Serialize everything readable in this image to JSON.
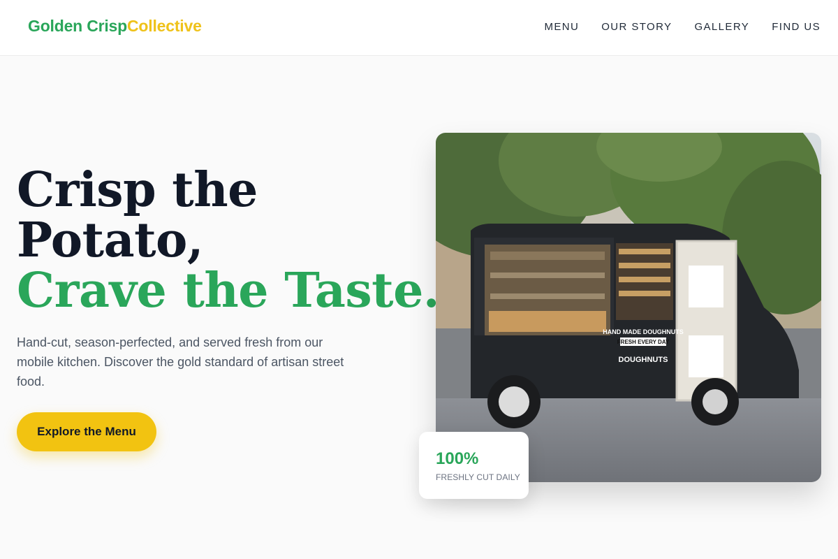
{
  "header": {
    "logo_part1": "Golden Crisp",
    "logo_part2": "Collective",
    "nav": [
      "MENU",
      "OUR STORY",
      "GALLERY",
      "FIND US"
    ]
  },
  "hero": {
    "title_line1": "Crisp the",
    "title_line2": "Potato,",
    "title_line3": "Crave the Taste.",
    "description": "Hand-cut, season-perfected, and served fresh from our mobile kitchen. Discover the gold standard of artisan street food.",
    "cta_label": "Explore the Menu"
  },
  "image": {
    "truck_signs": [
      "HAND MADE DOUGHNUTS",
      "FRESH EVERY DAY",
      "DOUGHNUTS"
    ]
  },
  "stat": {
    "value": "100%",
    "label": "FRESHLY CUT DAILY"
  },
  "colors": {
    "brand_green": "#2aa65a",
    "brand_gold": "#efc21a",
    "cta_gold": "#f2c311",
    "heading_dark": "#111827"
  }
}
